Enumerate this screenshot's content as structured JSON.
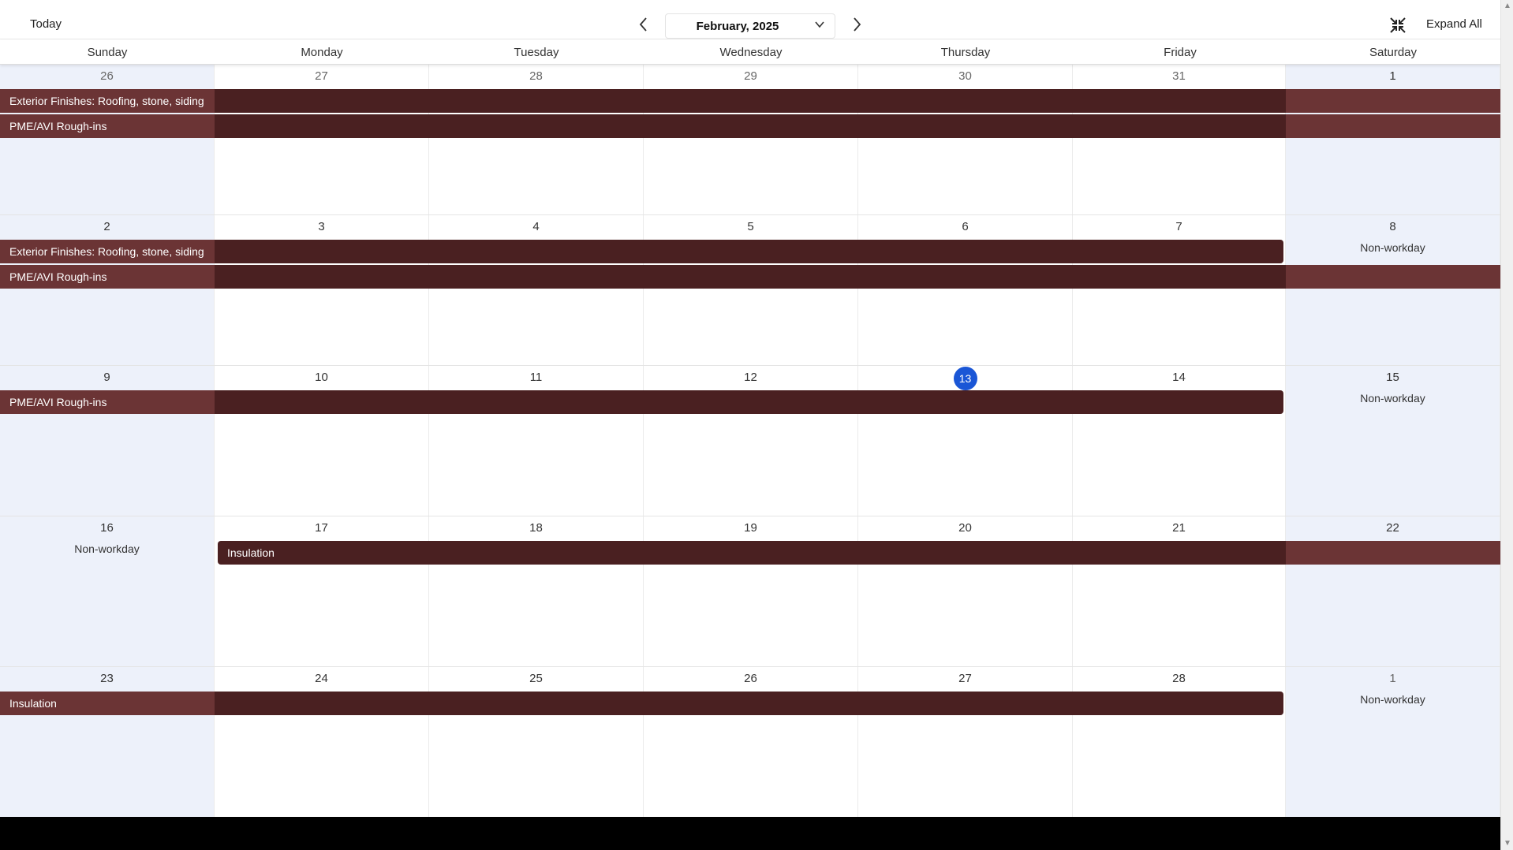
{
  "toolbar": {
    "today_label": "Today",
    "month_label": "February, 2025",
    "expand_all_label": "Expand All"
  },
  "days": [
    "Sunday",
    "Monday",
    "Tuesday",
    "Wednesday",
    "Thursday",
    "Friday",
    "Saturday"
  ],
  "non_workday_label": "Non-workday",
  "colors": {
    "event": "#4a2021",
    "event_weekend": "#6b3435",
    "today": "#1a56d6",
    "weekend_bg": "#edf1fa"
  },
  "weeks": [
    {
      "dates": [
        26,
        27,
        28,
        29,
        30,
        31,
        1
      ],
      "other_month": [
        true,
        true,
        true,
        true,
        true,
        true,
        false
      ],
      "non_workday": [
        false,
        false,
        false,
        false,
        false,
        false,
        false
      ],
      "events": [
        {
          "title": "Exterior Finishes: Roofing, stone, siding",
          "start": 0,
          "end": 6
        },
        {
          "title": "PME/AVI Rough-ins",
          "start": 0,
          "end": 6
        }
      ]
    },
    {
      "dates": [
        2,
        3,
        4,
        5,
        6,
        7,
        8
      ],
      "other_month": [
        false,
        false,
        false,
        false,
        false,
        false,
        false
      ],
      "non_workday": [
        false,
        false,
        false,
        false,
        false,
        false,
        true
      ],
      "events": [
        {
          "title": "Exterior Finishes: Roofing, stone, siding",
          "start": 0,
          "end": 5
        },
        {
          "title": "PME/AVI Rough-ins",
          "start": 0,
          "end": 6
        }
      ]
    },
    {
      "dates": [
        9,
        10,
        11,
        12,
        13,
        14,
        15
      ],
      "other_month": [
        false,
        false,
        false,
        false,
        false,
        false,
        false
      ],
      "non_workday": [
        false,
        false,
        false,
        false,
        false,
        false,
        true
      ],
      "today_index": 4,
      "events": [
        {
          "title": "PME/AVI Rough-ins",
          "start": 0,
          "end": 5
        }
      ]
    },
    {
      "dates": [
        16,
        17,
        18,
        19,
        20,
        21,
        22
      ],
      "other_month": [
        false,
        false,
        false,
        false,
        false,
        false,
        false
      ],
      "non_workday": [
        true,
        false,
        false,
        false,
        false,
        false,
        false
      ],
      "events": [
        {
          "title": "Insulation",
          "start": 1,
          "end": 6
        }
      ]
    },
    {
      "dates": [
        23,
        24,
        25,
        26,
        27,
        28,
        1
      ],
      "other_month": [
        false,
        false,
        false,
        false,
        false,
        false,
        true
      ],
      "non_workday": [
        false,
        false,
        false,
        false,
        false,
        false,
        true
      ],
      "events": [
        {
          "title": "Insulation",
          "start": 0,
          "end": 5
        }
      ]
    }
  ]
}
